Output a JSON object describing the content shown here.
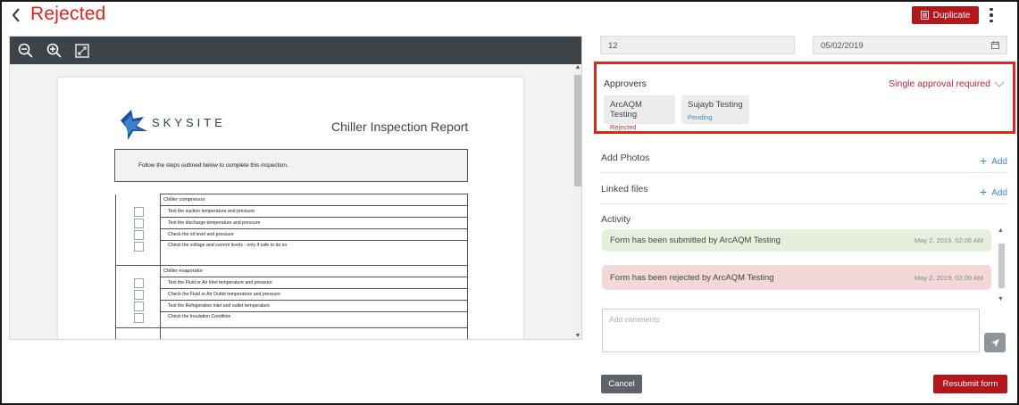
{
  "header": {
    "title": "Rejected",
    "duplicate_label": "Duplicate",
    "title_color": "#e0241c",
    "accent_color": "#b3161b"
  },
  "viewer": {
    "toolbar_icons": [
      "zoom-out-icon",
      "zoom-in-icon",
      "fullscreen-icon"
    ],
    "document": {
      "logo_text": "SKYSITE",
      "title": "Chiller Inspection Report",
      "instructions": "Follow the steps outlined below to complete this inspection.",
      "sections": [
        {
          "heading": "Chiller compressor",
          "items": [
            "Test the suction temperature and pressure",
            "Test the discharge temperature and pressure",
            "Check the oil level and pressure",
            "Check the voltage and current levels - only if safe to do so"
          ]
        },
        {
          "heading": "Chiller evaporator",
          "items": [
            "Test the Fluid or Air Inlet temperature and pressure",
            "Check the Fluid or Air Outlet temperature and pressure",
            "Test the Refrigeration inlet and outlet temperature",
            "Check the Insulation Condition"
          ]
        }
      ]
    }
  },
  "fields": {
    "number_value": "12",
    "date_value": "05/02/2019"
  },
  "approvers": {
    "title": "Approvers",
    "requirement": "Single approval required",
    "border_color": "#e1251b",
    "list": [
      {
        "name": "ArcAQM Testing",
        "status": "Rejected",
        "status_color": "#d9342b"
      },
      {
        "name": "Sujayb Testing",
        "status": "Pending",
        "status_color": "#3a8ac9"
      }
    ]
  },
  "photos": {
    "label": "Add Photos",
    "add_label": "Add"
  },
  "linked_files": {
    "label": "Linked files",
    "add_label": "Add"
  },
  "activity": {
    "title": "Activity",
    "items": [
      {
        "message": "Form has been submitted by ArcAQM Testing",
        "time": "May 2, 2019, 02:08 AM",
        "color": "#e4f0dc"
      },
      {
        "message": "Form has been rejected by ArcAQM Testing",
        "time": "May 2, 2019, 02:09 AM",
        "color": "#f2d9d8"
      }
    ]
  },
  "comments": {
    "placeholder": "Add comments"
  },
  "footer": {
    "cancel_label": "Cancel",
    "resubmit_label": "Resubmit form"
  }
}
